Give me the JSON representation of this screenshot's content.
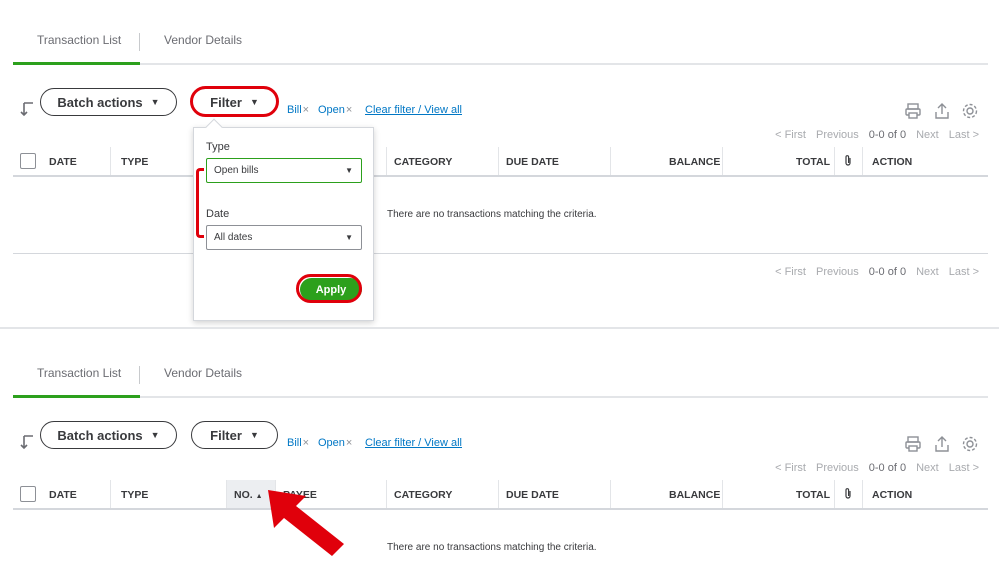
{
  "tabs": [
    "Transaction List",
    "Vendor Details"
  ],
  "toolbar": {
    "batch_actions_label": "Batch actions",
    "filter_label": "Filter",
    "chip_bill": "Bill",
    "chip_open": "Open",
    "chip_remove": "×",
    "clear_filter": "Clear filter / View all"
  },
  "pager": {
    "first": "< First",
    "previous": "Previous",
    "count": "0-0 of 0",
    "next": "Next",
    "last": "Last >"
  },
  "columns": {
    "date": "DATE",
    "type": "TYPE",
    "no": "NO.",
    "payee": "PAYEE",
    "category": "CATEGORY",
    "due_date": "DUE DATE",
    "balance": "BALANCE",
    "total": "TOTAL",
    "attachment": "attachment-icon",
    "action": "ACTION"
  },
  "empty_message": "There are no transactions matching the criteria.",
  "filter_dropdown": {
    "type_label": "Type",
    "type_value": "Open bills",
    "date_label": "Date",
    "date_value": "All dates",
    "apply_label": "Apply"
  },
  "colors": {
    "accent_green": "#2ca01c",
    "link_blue": "#0077c5",
    "highlight_red": "#e0000b"
  },
  "icons": [
    "sort-arrow-icon",
    "print-icon",
    "export-icon",
    "gear-icon",
    "caret-down-icon",
    "paperclip-icon",
    "red-arrow-icon"
  ]
}
